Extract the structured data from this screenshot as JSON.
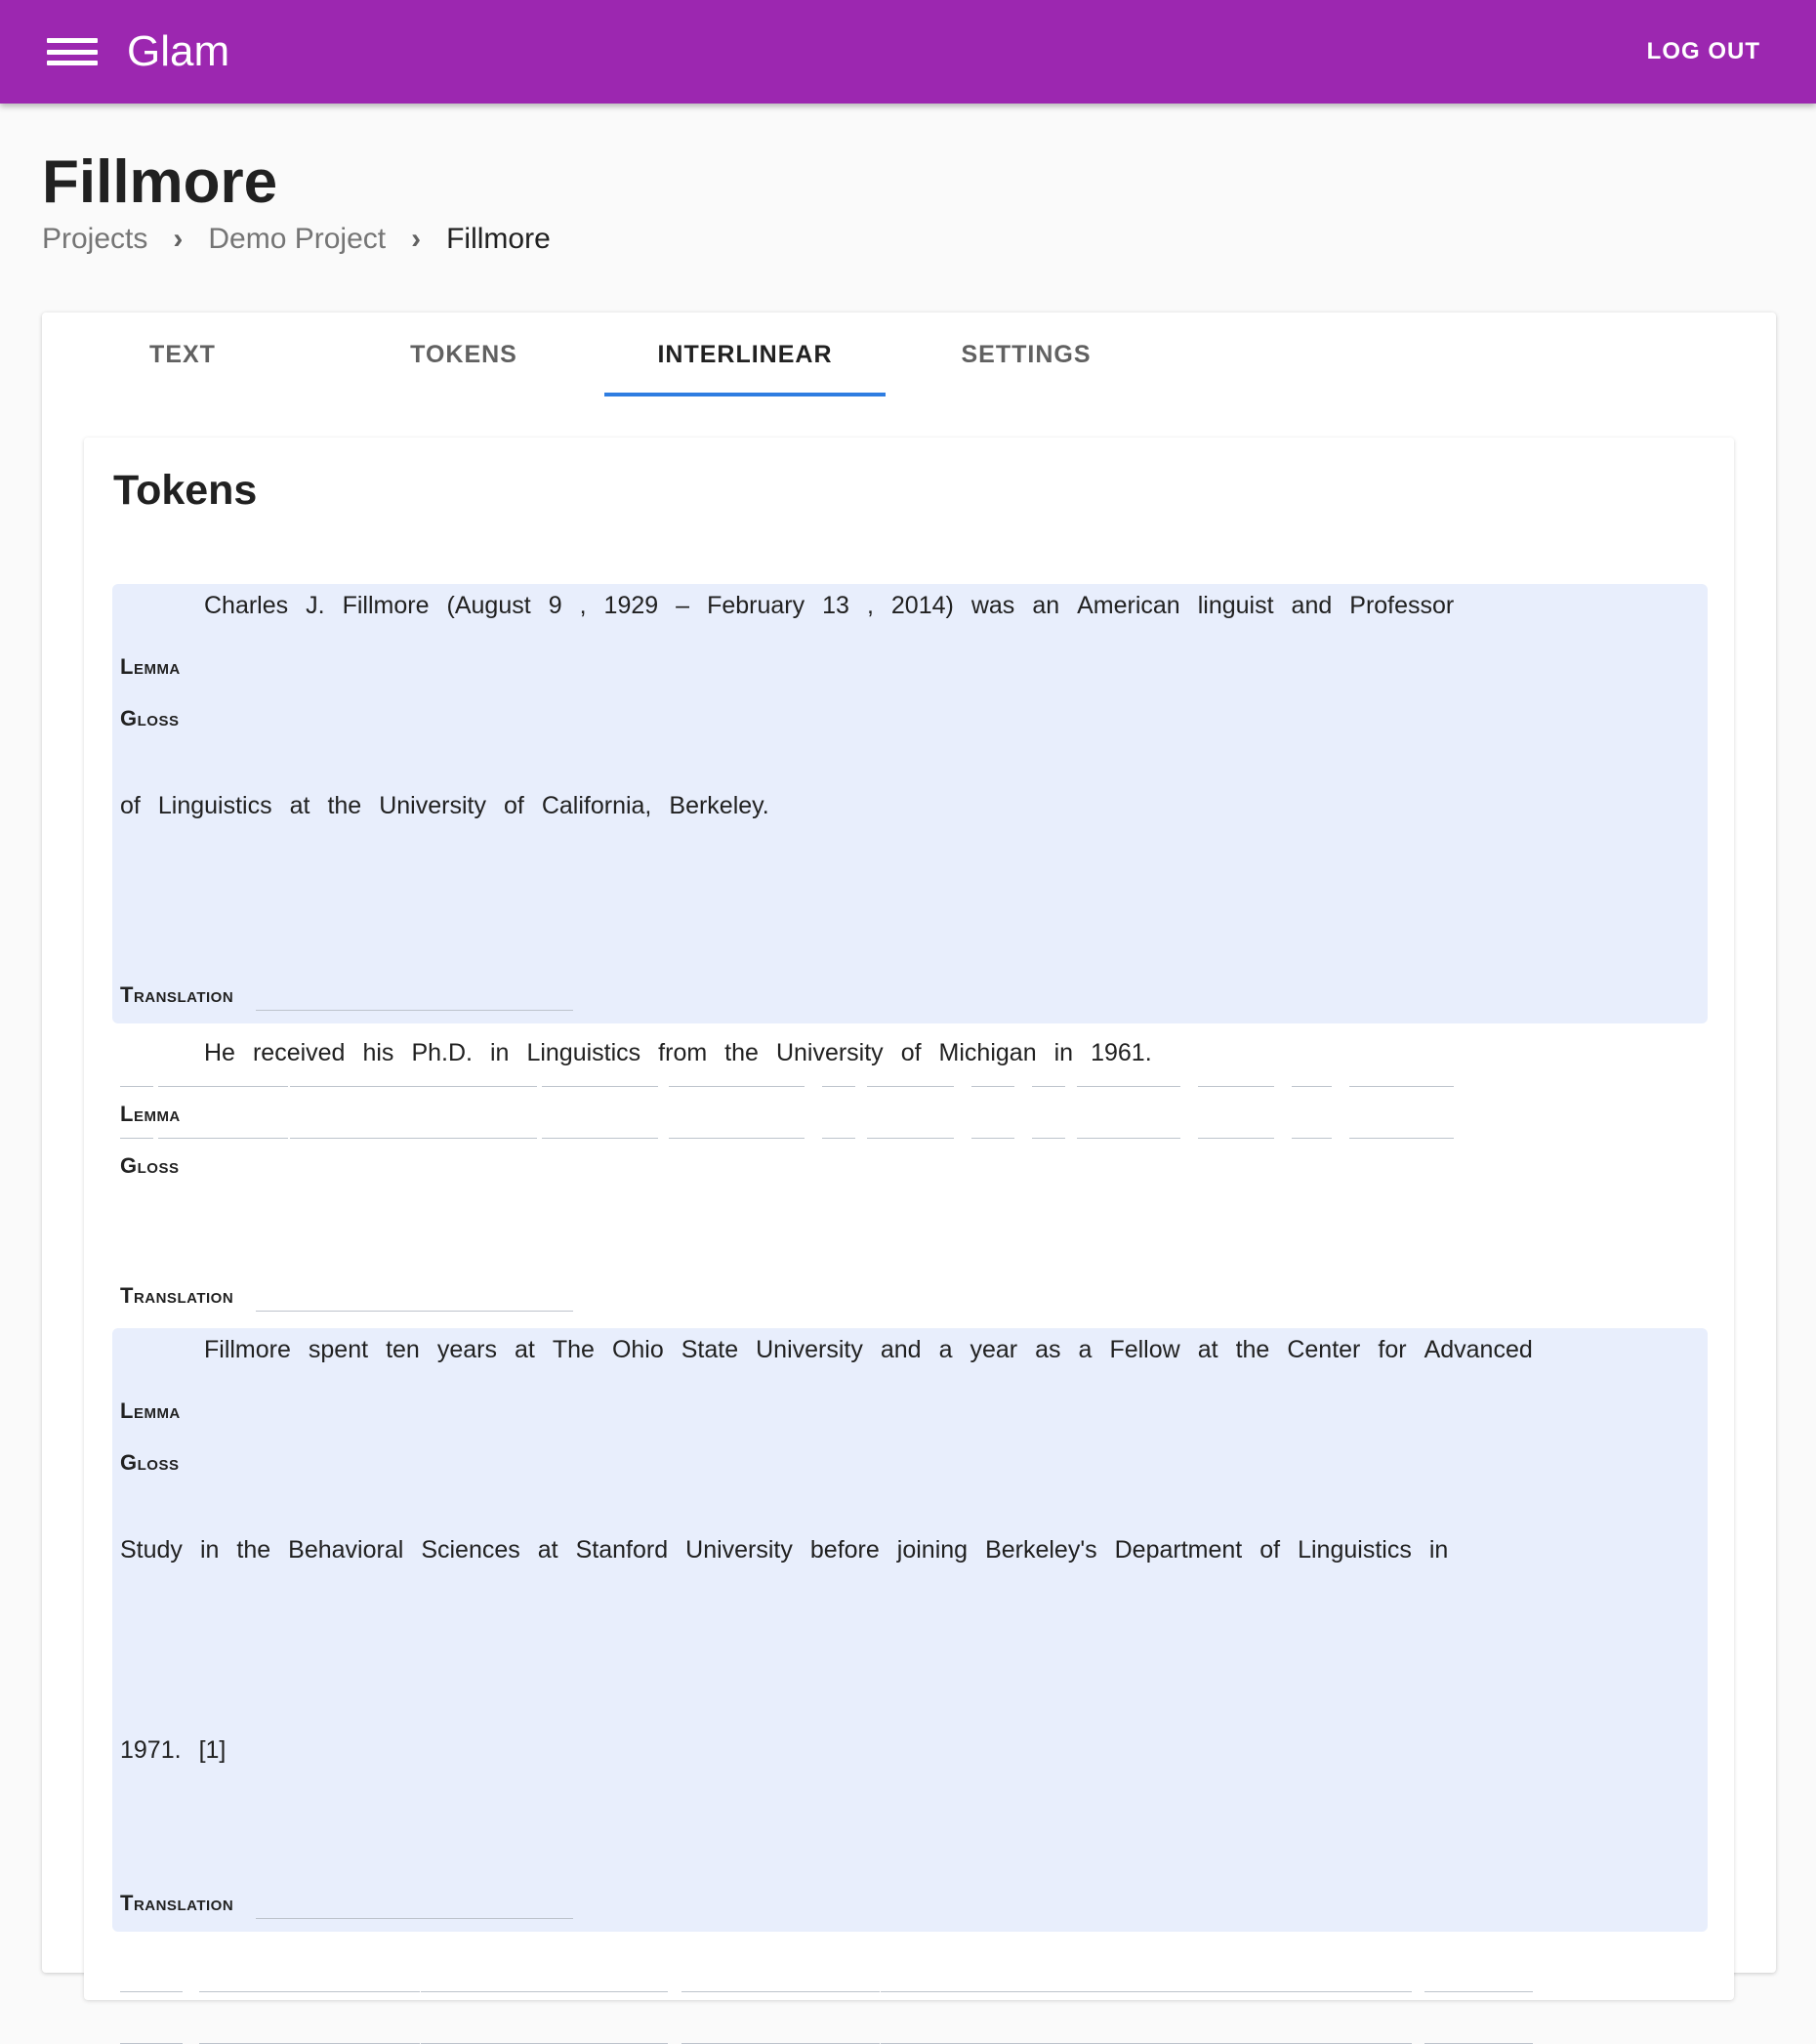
{
  "app": {
    "title": "Glam",
    "logout_label": "LOG OUT"
  },
  "page": {
    "title": "Fillmore"
  },
  "breadcrumb": [
    {
      "label": "Projects"
    },
    {
      "label": "Demo Project"
    },
    {
      "label": "Fillmore"
    }
  ],
  "tabs": [
    {
      "label": "TEXT",
      "active": false
    },
    {
      "label": "TOKENS",
      "active": false
    },
    {
      "label": "INTERLINEAR",
      "active": true
    },
    {
      "label": "SETTINGS",
      "active": false
    }
  ],
  "section_title": "Tokens",
  "labels": {
    "lemma": "Lemma",
    "gloss": "Gloss",
    "translation": "Translation"
  },
  "sentences": [
    {
      "shaded": true,
      "lines": [
        [
          "Charles",
          "J.",
          "Fillmore",
          "(August",
          "9",
          ",",
          "1929",
          "–",
          "February",
          "13",
          ",",
          "2014)",
          "was",
          "an",
          "American",
          "linguist",
          "and",
          "Professor"
        ],
        [
          "of",
          "Linguistics",
          "at",
          "the",
          "University",
          "of",
          "California,",
          "Berkeley."
        ]
      ]
    },
    {
      "shaded": false,
      "lines": [
        [
          "He",
          "received",
          "his",
          "Ph.D.",
          "in",
          "Linguistics",
          "from",
          "the",
          "University",
          "of",
          "Michigan",
          "in",
          "1961."
        ]
      ]
    },
    {
      "shaded": true,
      "lines": [
        [
          "Fillmore",
          "spent",
          "ten",
          "years",
          "at",
          "The",
          "Ohio",
          "State",
          "University",
          "and",
          "a",
          "year",
          "as",
          "a",
          "Fellow",
          "at",
          "the",
          "Center",
          "for",
          "Advanced"
        ],
        [
          "Study",
          "in",
          "the",
          "Behavioral",
          "Sciences",
          "at",
          "Stanford",
          "University",
          "before",
          "joining",
          "Berkeley's",
          "Department",
          "of",
          "Linguistics",
          "in"
        ],
        [
          "1971.",
          "[1]"
        ]
      ]
    }
  ]
}
